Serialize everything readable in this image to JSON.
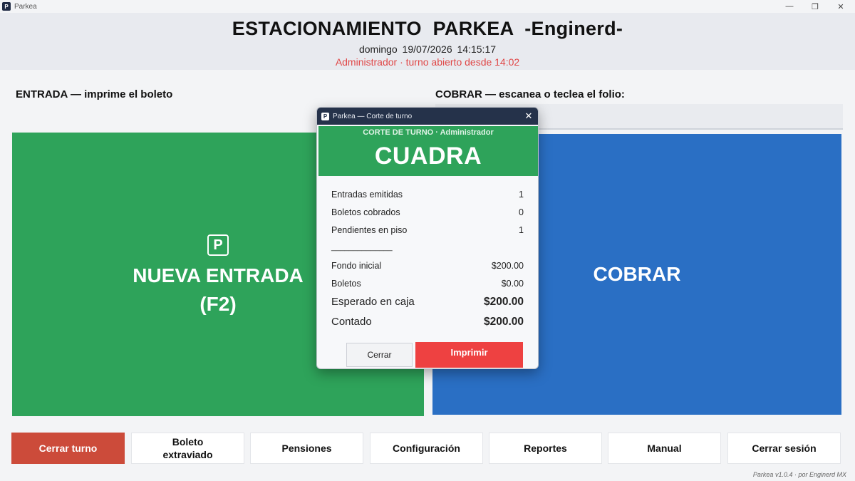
{
  "window": {
    "title": "Parkea",
    "app_icon": "P",
    "controls": {
      "minimize": "—",
      "maximize": "❐",
      "close": "✕"
    }
  },
  "header": {
    "title": "ESTACIONAMIENTO   PARKEA   -Enginerd-",
    "datetime": "domingo 19/07/2026   14:15:17",
    "shift_status": "Administrador  ·  turno abierto desde 14:02"
  },
  "entrada": {
    "label": "ENTRADA — imprime el boleto",
    "icon": "P",
    "button_line1": "NUEVA ENTRADA",
    "button_line2": "(F2)"
  },
  "cobrar": {
    "label": "COBRAR — escanea o teclea el folio:",
    "input_value": "",
    "input_placeholder": "",
    "button_label": "COBRAR"
  },
  "bottom_bar": {
    "cerrar_turno": "Cerrar turno",
    "boleto_extraviado_1": "Boleto",
    "boleto_extraviado_2": "extraviado",
    "pensiones": "Pensiones",
    "configuracion": "Configuración",
    "reportes": "Reportes",
    "manual": "Manual",
    "cerrar_sesion": "Cerrar sesión"
  },
  "footer": {
    "version": "Parkea v1.0.4 · por Enginerd MX"
  },
  "dialog": {
    "title": "Parkea — Corte de turno",
    "close": "✕",
    "banner_subtitle": "CORTE DE TURNO · Administrador",
    "banner_status": "CUADRA",
    "rows": [
      {
        "label": "Entradas emitidas",
        "value": "1"
      },
      {
        "label": "Boletos cobrados",
        "value": "0"
      },
      {
        "label": "Pendientes en piso",
        "value": "1"
      }
    ],
    "separator": "______________",
    "money_rows": [
      {
        "label": "Fondo inicial",
        "value": "$200.00"
      },
      {
        "label": "Boletos",
        "value": "$0.00"
      }
    ],
    "totals": [
      {
        "label": "Esperado en caja",
        "value": "$200.00"
      },
      {
        "label": "Contado",
        "value": "$200.00"
      }
    ],
    "btn_cerrar": "Cerrar",
    "btn_imprimir": "Imprimir"
  },
  "colors": {
    "entrada_green": "#2ea35a",
    "cobrar_blue": "#2a6fc4",
    "cerrar_turno_red": "#cc4b3a",
    "imprimir_red": "#ee4141",
    "shift_text_red": "#e04848",
    "dialog_titlebar": "#25324a"
  }
}
